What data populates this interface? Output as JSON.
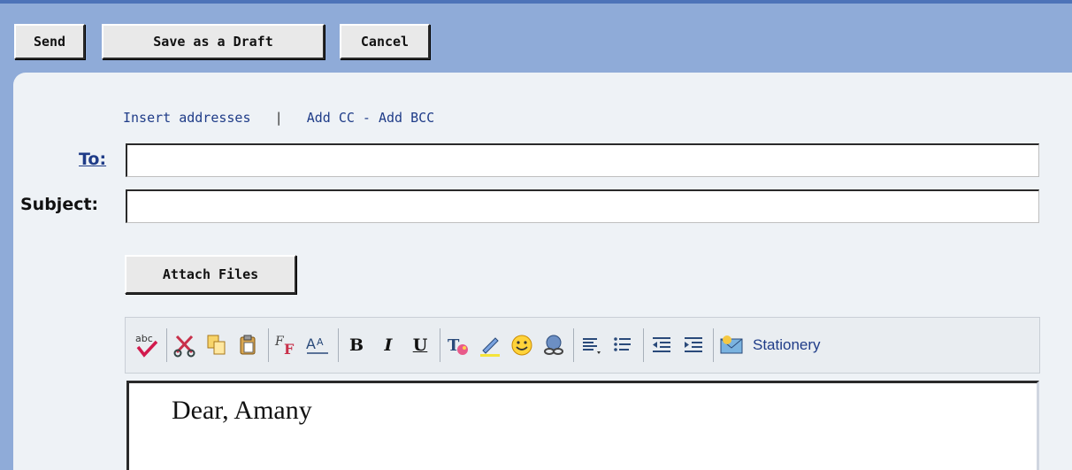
{
  "toolbar_top": {
    "send_label": "Send",
    "save_draft_label": "Save as a Draft",
    "cancel_label": "Cancel"
  },
  "compose": {
    "insert_addresses_link": "Insert addresses",
    "separator": "|",
    "cc_bcc_link": "Add CC - Add BCC",
    "to_label": "To:",
    "to_value": "",
    "subject_label": "Subject:",
    "subject_value": "",
    "attach_label": "Attach Files",
    "body_text": "Dear, Amany"
  },
  "editor_toolbar": {
    "icons": [
      "spellcheck-icon",
      "cut-icon",
      "copy-icon",
      "paste-icon",
      "font-icon",
      "font-size-icon",
      "bold-icon",
      "italic-icon",
      "underline-icon",
      "text-color-icon",
      "highlight-icon",
      "emoticon-icon",
      "link-icon",
      "align-icon",
      "bullet-list-icon",
      "outdent-icon",
      "indent-icon",
      "stationery-icon"
    ],
    "bold_glyph": "B",
    "italic_glyph": "I",
    "underline_glyph": "U",
    "stationery_label": "Stationery"
  },
  "colors": {
    "header_blue": "#8fabd8",
    "panel_bg": "#eef2f6",
    "link_blue": "#1f3c88"
  }
}
